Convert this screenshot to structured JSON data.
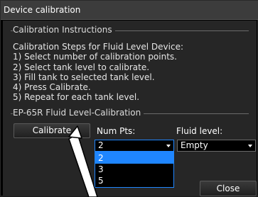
{
  "window": {
    "title": "Device calibration"
  },
  "instructions": {
    "heading": "Calibration Instructions",
    "lines": [
      "Calibration Steps for Fluid Level Device:",
      "1) Select number of calibration points.",
      "2) Select tank level to calibrate.",
      "3) Fill tank to selected tank level.",
      "4) Press Calibrate.",
      "5) Repeat for each tank level."
    ]
  },
  "calibration": {
    "heading": "EP-65R Fluid Level-Calibration",
    "calibrate_label": "Calibrate",
    "num_pts_label": "Num Pts:",
    "num_pts_value": "2",
    "num_pts_options": [
      "2",
      "3",
      "5"
    ],
    "fluid_level_label": "Fluid level:",
    "fluid_level_value": "Empty"
  },
  "footer": {
    "close_label": "Close"
  },
  "colors": {
    "accent": "#1f86ff",
    "panel": "#262626",
    "titlebar": "#3c3c3c"
  }
}
